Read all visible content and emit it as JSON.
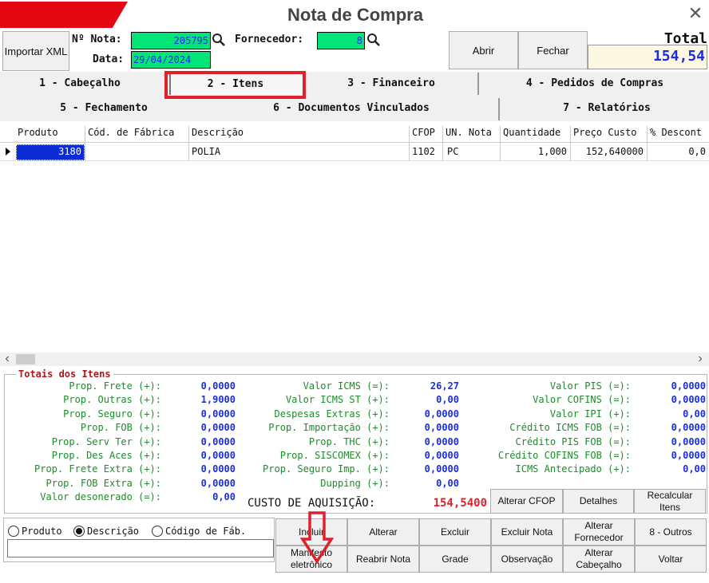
{
  "window": {
    "title": "Nota de Compra",
    "close_glyph": "✕"
  },
  "toolbar": {
    "import_xml": "Importar XML",
    "nota_label": "Nº Nota:",
    "nota_value": "205795",
    "fornecedor_label": "Fornecedor:",
    "fornecedor_value": "8",
    "data_label": "Data:",
    "data_value": "29/04/2024",
    "abrir": "Abrir",
    "fechar": "Fechar",
    "total_label": "Total",
    "total_value": "154,54"
  },
  "tabs": {
    "row1": [
      "1 - Cabeçalho",
      "2 - Itens",
      "3 - Financeiro",
      "4 - Pedidos de Compras"
    ],
    "row2": [
      "5 - Fechamento",
      "6 - Documentos Vinculados",
      "7 - Relatórios"
    ],
    "active": "2 - Itens"
  },
  "grid": {
    "columns": [
      "Produto",
      "Cód. de Fábrica",
      "Descrição",
      "CFOP",
      "UN. Nota",
      "Quantidade",
      "Preço Custo",
      "% Descont"
    ],
    "rows": [
      {
        "produto": "3180",
        "cod_fabrica": "",
        "descricao": "POLIA",
        "cfop": "1102",
        "un": "PC",
        "quantidade": "1,000",
        "preco": "152,640000",
        "desconto": "0,0"
      }
    ]
  },
  "scroll": {
    "left": "‹",
    "right": "›"
  },
  "totais": {
    "title": "Totais dos Itens",
    "col1": [
      [
        "Prop. Frete (+):",
        "0,0000"
      ],
      [
        "Prop. Outras (+):",
        "1,9000"
      ],
      [
        "Prop. Seguro (+):",
        "0,0000"
      ],
      [
        "Prop. FOB (+):",
        "0,0000"
      ],
      [
        "Prop. Serv Ter (+):",
        "0,0000"
      ],
      [
        "Prop. Des Aces (+):",
        "0,0000"
      ],
      [
        "Prop. Frete Extra (+):",
        "0,0000"
      ],
      [
        "Prop. FOB Extra (+):",
        "0,0000"
      ],
      [
        "Valor desonerado (=):",
        "0,00"
      ]
    ],
    "col2": [
      [
        "Valor ICMS (=):",
        "26,27"
      ],
      [
        "Valor ICMS ST (+):",
        "0,00"
      ],
      [
        "Despesas Extras (+):",
        "0,0000"
      ],
      [
        "Prop. Importação (+):",
        "0,0000"
      ],
      [
        "Prop. THC (+):",
        "0,0000"
      ],
      [
        "Prop. SISCOMEX (+):",
        "0,0000"
      ],
      [
        "Prop. Seguro Imp. (+):",
        "0,0000"
      ],
      [
        "Dupping (+):",
        "0,00"
      ]
    ],
    "col3": [
      [
        "Valor PIS (=):",
        "0,0000"
      ],
      [
        "Valor COFINS (=):",
        "0,0000"
      ],
      [
        "Valor IPI (+):",
        "0,00"
      ],
      [
        "Crédito ICMS FOB (=):",
        "0,0000"
      ],
      [
        "Crédito PIS FOB (=):",
        "0,0000"
      ],
      [
        "Crédito COFINS FOB (=):",
        "0,0000"
      ],
      [
        "ICMS Antecipado (+):",
        "0,00"
      ]
    ],
    "custo_label": "CUSTO DE AQUISIÇÃO:",
    "custo_value": "154,5400"
  },
  "side_buttons": {
    "alterar_cfop": "Alterar CFOP",
    "detalhes": "Detalhes",
    "recalcular": "Recalcular Itens"
  },
  "search": {
    "options": [
      "Produto",
      "Descrição",
      "Código de Fáb."
    ],
    "selected": "Descrição",
    "value": ""
  },
  "actions": {
    "row1": [
      "Incluir",
      "Alterar",
      "Excluir",
      "Excluir Nota",
      "Alterar Fornecedor",
      "8 - Outros"
    ],
    "row2": [
      "Manifesto eletrônico",
      "Reabrir Nota",
      "Grade",
      "Observação",
      "Alterar Cabeçalho",
      "Voltar"
    ]
  },
  "colors": {
    "accent_red": "#e30613",
    "field_green": "#00e676",
    "value_blue": "#1a2ee0",
    "label_green": "#1f8b2b",
    "highlight_red": "#e0202a"
  }
}
